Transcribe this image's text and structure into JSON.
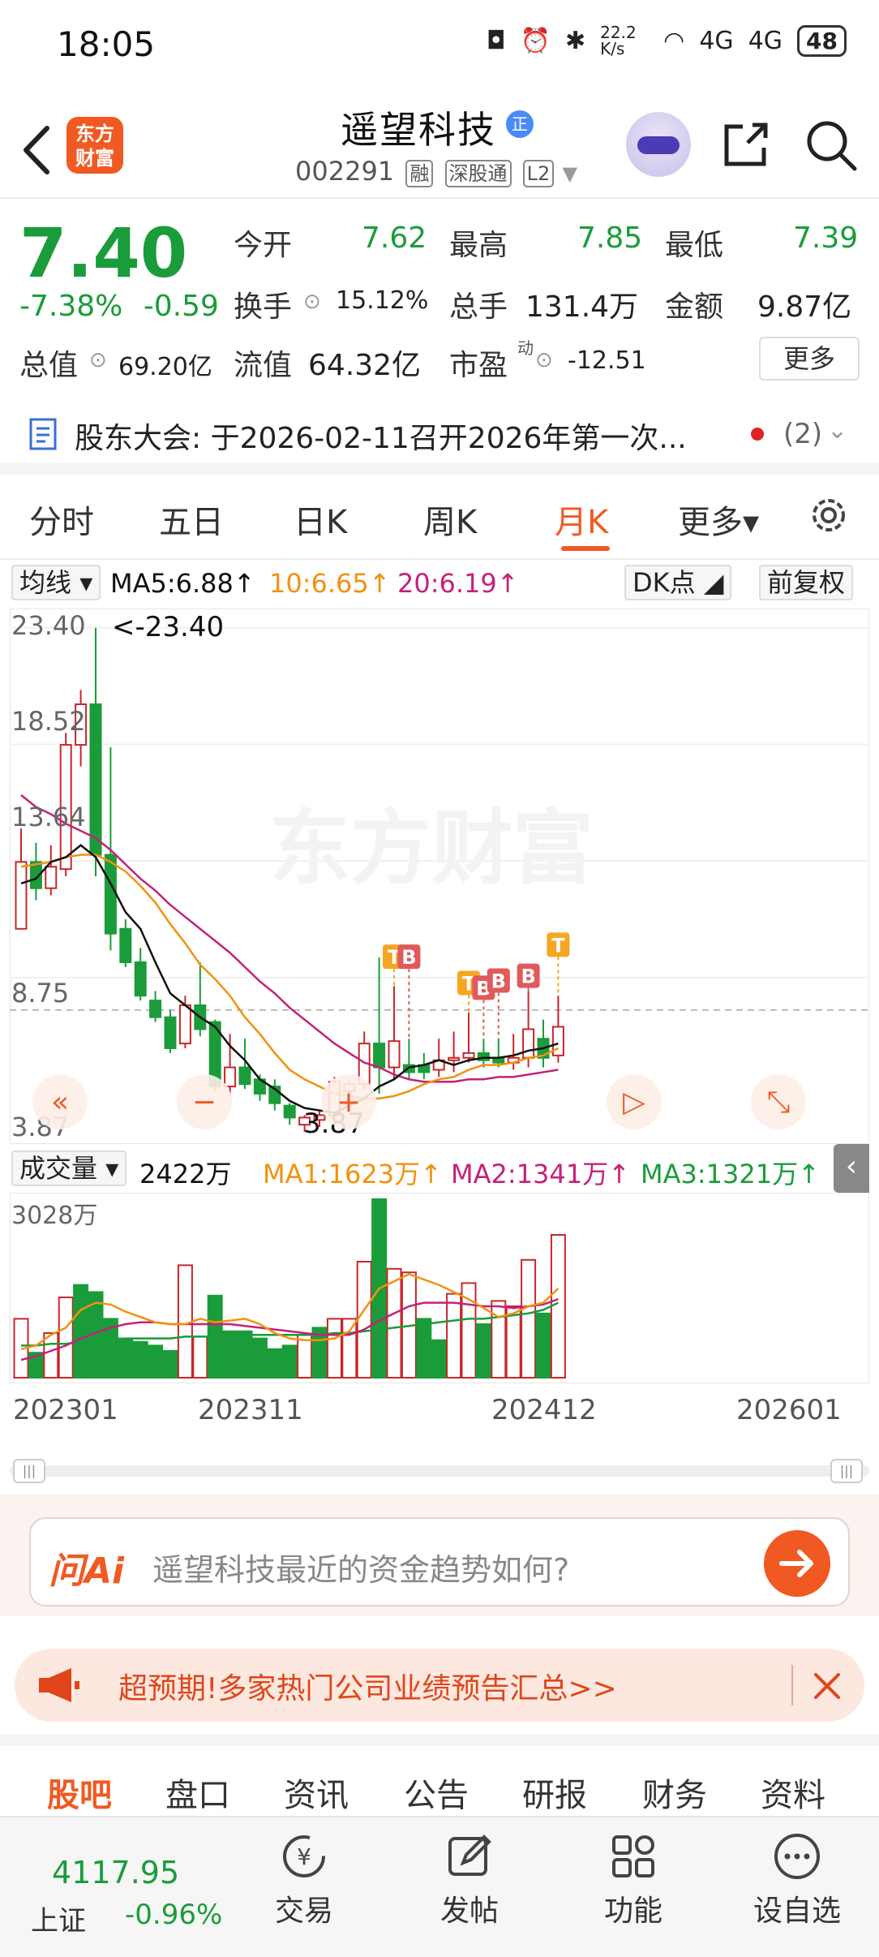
{
  "status": {
    "time": "18:05",
    "net_speed": "22.2 K/s",
    "signal1": "4G",
    "signal2": "4G",
    "battery": "48"
  },
  "header": {
    "logo_text": "东方财富",
    "stock_name": "遥望科技",
    "name_badge": "正",
    "stock_code": "002291",
    "tags": [
      "融",
      "深股通",
      "L2"
    ]
  },
  "quote": {
    "price": "7.40",
    "change_pct": "-7.38%",
    "change_abs": "-0.59",
    "open_label": "今开",
    "open": "7.62",
    "high_label": "最高",
    "high": "7.85",
    "low_label": "最低",
    "low": "7.39",
    "turnover_label": "换手",
    "turnover": "15.12%",
    "volume_label": "总手",
    "volume": "131.4万",
    "amount_label": "金额",
    "amount": "9.87亿",
    "mcap_label": "总值",
    "mcap": "69.20亿",
    "float_label": "流值",
    "float_cap": "64.32亿",
    "pe_label": "市盈",
    "pe_sup": "动",
    "pe": "-12.51",
    "more_label": "更多"
  },
  "notice": {
    "text": "股东大会:  于2026-02-11召开2026年第一次...",
    "count": "(2)"
  },
  "tabs": [
    {
      "label": "分时"
    },
    {
      "label": "五日"
    },
    {
      "label": "日K"
    },
    {
      "label": "周K"
    },
    {
      "label": "月K"
    },
    {
      "label": "更多▾"
    }
  ],
  "ma_row": {
    "type": "均线",
    "ma5": "MA5:6.88↑",
    "ma10": "10:6.65↑",
    "ma20": "20:6.19↑",
    "dk": "DK点",
    "adjust": "前复权"
  },
  "price_axis": {
    "labels": [
      "23.40",
      "18.52",
      "13.64",
      "8.75",
      "3.87"
    ],
    "max_label": "<-23.40",
    "min_label": "3.87",
    "watermark": "东方财富"
  },
  "markers": [
    "T",
    "B",
    "T",
    "B",
    "B",
    "B",
    "T"
  ],
  "volume_row": {
    "type": "成交量",
    "vol": "2422万",
    "ma1": "MA1:1623万↑",
    "ma2": "MA2:1341万↑",
    "ma3": "MA3:1321万↑",
    "vol_axis": "3028万"
  },
  "dates": [
    "202301",
    "202311",
    "202412",
    "202601"
  ],
  "ai": {
    "logo": "问Ai",
    "prompt": "遥望科技最近的资金趋势如何?"
  },
  "promo": {
    "text": "超预期!多家热门公司业绩预告汇总>>"
  },
  "bottom_tabs": [
    {
      "label": "股吧"
    },
    {
      "label": "盘口"
    },
    {
      "label": "资讯"
    },
    {
      "label": "公告"
    },
    {
      "label": "研报"
    },
    {
      "label": "财务"
    },
    {
      "label": "资料"
    }
  ],
  "index": {
    "value": "4117.95",
    "name": "上证",
    "change": "-0.96%"
  },
  "nav": [
    {
      "label": "交易"
    },
    {
      "label": "发帖"
    },
    {
      "label": "功能"
    },
    {
      "label": "设自选"
    }
  ],
  "colors": {
    "up": "#c8262b",
    "down": "#1a9c3a",
    "accent": "#f05a22",
    "ma5": "#111111",
    "ma10": "#f0920f",
    "ma20": "#c4217a"
  },
  "chart_data": {
    "type": "candlestick",
    "title": "",
    "xlabel": "",
    "ylabel": "",
    "ylim": [
      3.87,
      23.4
    ],
    "candles": [
      [
        10.8,
        13.6,
        12.2,
        15.0,
        "u"
      ],
      [
        13.6,
        12.5,
        12.0,
        14.4,
        "d"
      ],
      [
        12.5,
        13.4,
        12.2,
        14.3,
        "u"
      ],
      [
        13.3,
        18.5,
        13.0,
        19.0,
        "u"
      ],
      [
        18.5,
        20.2,
        17.6,
        20.8,
        "u"
      ],
      [
        20.2,
        13.9,
        13.0,
        23.4,
        "d"
      ],
      [
        13.9,
        10.6,
        9.9,
        18.4,
        "d"
      ],
      [
        10.8,
        9.4,
        9.2,
        11.2,
        "d"
      ],
      [
        9.4,
        8.0,
        7.8,
        10.0,
        "d"
      ],
      [
        7.8,
        7.1,
        6.9,
        8.2,
        "d"
      ],
      [
        7.1,
        5.8,
        5.6,
        7.4,
        "d"
      ],
      [
        6.0,
        7.6,
        5.8,
        8.0,
        "u"
      ],
      [
        7.6,
        6.6,
        6.3,
        9.4,
        "d"
      ],
      [
        6.9,
        4.2,
        4.0,
        7.0,
        "d"
      ],
      [
        4.2,
        5.0,
        3.8,
        6.4,
        "u"
      ],
      [
        5.0,
        4.3,
        4.1,
        6.2,
        "d"
      ],
      [
        4.5,
        3.9,
        3.6,
        4.7,
        "d"
      ],
      [
        4.2,
        3.5,
        3.2,
        4.5,
        "d"
      ],
      [
        3.4,
        2.9,
        2.6,
        3.5,
        "d"
      ],
      [
        2.6,
        2.9,
        2.3,
        3.0,
        "u"
      ],
      [
        2.8,
        3.0,
        2.5,
        3.2,
        "u"
      ],
      [
        3.0,
        4.4,
        2.8,
        4.6,
        "u"
      ],
      [
        4.0,
        4.3,
        3.6,
        4.4,
        "u"
      ],
      [
        4.3,
        6.0,
        4.1,
        6.5,
        "u"
      ],
      [
        6.0,
        5.0,
        3.9,
        9.6,
        "d"
      ],
      [
        5.0,
        6.1,
        4.5,
        8.4,
        "u"
      ],
      [
        5.1,
        4.8,
        4.5,
        6.2,
        "d"
      ],
      [
        5.1,
        4.8,
        4.5,
        5.6,
        "d"
      ],
      [
        4.9,
        5.3,
        4.6,
        6.2,
        "u"
      ],
      [
        5.3,
        5.4,
        4.8,
        6.5,
        "u"
      ],
      [
        5.4,
        5.6,
        5.2,
        7.3,
        "u"
      ],
      [
        5.6,
        5.3,
        5.0,
        6.2,
        "d"
      ],
      [
        5.4,
        5.2,
        5.0,
        6.2,
        "d"
      ],
      [
        5.2,
        5.4,
        4.9,
        6.4,
        "u"
      ],
      [
        5.4,
        6.6,
        5.0,
        8.2,
        "u"
      ],
      [
        6.2,
        5.4,
        5.0,
        7.0,
        "d"
      ],
      [
        5.5,
        6.7,
        5.2,
        8.0,
        "u"
      ]
    ],
    "ma5": [
      12.7,
      12.9,
      13.6,
      13.8,
      14.3,
      13.8,
      12.7,
      11.5,
      10.8,
      9.4,
      8.1,
      7.6,
      7.1,
      6.7,
      5.9,
      5.3,
      4.5,
      4.1,
      3.6,
      3.3,
      3.2,
      3.1,
      3.4,
      3.7,
      4.2,
      4.5,
      5.0,
      5.1,
      5.3,
      5.1,
      5.3,
      5.4,
      5.4,
      5.5,
      5.7,
      5.8,
      6.0
    ],
    "ma10": [
      13.4,
      13.5,
      13.6,
      13.8,
      13.9,
      13.9,
      13.6,
      13.2,
      12.6,
      11.9,
      11.0,
      10.2,
      9.3,
      8.7,
      8.0,
      7.1,
      6.4,
      5.6,
      4.9,
      4.5,
      4.2,
      3.9,
      3.8,
      3.7,
      3.7,
      3.8,
      4.0,
      4.3,
      4.5,
      4.6,
      4.9,
      5.1,
      5.1,
      5.2,
      5.4,
      5.5,
      5.8
    ],
    "ma20": [
      16.4,
      15.9,
      15.6,
      15.2,
      14.9,
      14.6,
      14.1,
      13.5,
      12.9,
      12.4,
      11.8,
      11.3,
      10.8,
      10.3,
      9.8,
      9.2,
      8.6,
      8.1,
      7.5,
      7.0,
      6.5,
      6.0,
      5.6,
      5.2,
      5.0,
      4.7,
      4.5,
      4.4,
      4.4,
      4.4,
      4.5,
      4.5,
      4.6,
      4.6,
      4.7,
      4.8,
      4.9
    ],
    "volume": [
      [
        0.33,
        "u"
      ],
      [
        0.14,
        "d"
      ],
      [
        0.25,
        "u"
      ],
      [
        0.45,
        "u"
      ],
      [
        0.52,
        "d"
      ],
      [
        0.48,
        "d"
      ],
      [
        0.33,
        "d"
      ],
      [
        0.22,
        "d"
      ],
      [
        0.2,
        "d"
      ],
      [
        0.18,
        "d"
      ],
      [
        0.15,
        "d"
      ],
      [
        0.63,
        "u"
      ],
      [
        0.23,
        "u"
      ],
      [
        0.46,
        "d"
      ],
      [
        0.26,
        "d"
      ],
      [
        0.26,
        "d"
      ],
      [
        0.22,
        "d"
      ],
      [
        0.16,
        "d"
      ],
      [
        0.18,
        "d"
      ],
      [
        0.24,
        "u"
      ],
      [
        0.28,
        "d"
      ],
      [
        0.33,
        "u"
      ],
      [
        0.33,
        "u"
      ],
      [
        0.65,
        "u"
      ],
      [
        1.0,
        "d"
      ],
      [
        0.61,
        "u"
      ],
      [
        0.59,
        "u"
      ],
      [
        0.33,
        "d"
      ],
      [
        0.21,
        "d"
      ],
      [
        0.47,
        "u"
      ],
      [
        0.53,
        "u"
      ],
      [
        0.3,
        "d"
      ],
      [
        0.43,
        "u"
      ],
      [
        0.4,
        "u"
      ],
      [
        0.66,
        "u"
      ],
      [
        0.36,
        "d"
      ],
      [
        0.8,
        "u"
      ]
    ],
    "vol_ma1": [
      0.16,
      0.18,
      0.24,
      0.28,
      0.38,
      0.42,
      0.41,
      0.37,
      0.34,
      0.31,
      0.3,
      0.3,
      0.33,
      0.31,
      0.32,
      0.33,
      0.3,
      0.25,
      0.22,
      0.21,
      0.21,
      0.22,
      0.26,
      0.38,
      0.5,
      0.54,
      0.58,
      0.55,
      0.52,
      0.48,
      0.44,
      0.39,
      0.34,
      0.36,
      0.4,
      0.42,
      0.5
    ],
    "vol_ma2": [
      0.1,
      0.12,
      0.15,
      0.18,
      0.22,
      0.25,
      0.28,
      0.3,
      0.31,
      0.31,
      0.3,
      0.3,
      0.3,
      0.3,
      0.3,
      0.29,
      0.28,
      0.27,
      0.26,
      0.25,
      0.24,
      0.24,
      0.24,
      0.27,
      0.32,
      0.36,
      0.4,
      0.42,
      0.42,
      0.42,
      0.41,
      0.4,
      0.4,
      0.39,
      0.4,
      0.41,
      0.44
    ],
    "vol_ma3": [
      0.18,
      0.18,
      0.19,
      0.19,
      0.2,
      0.21,
      0.21,
      0.22,
      0.22,
      0.22,
      0.22,
      0.23,
      0.23,
      0.23,
      0.23,
      0.24,
      0.24,
      0.24,
      0.24,
      0.24,
      0.24,
      0.25,
      0.25,
      0.26,
      0.27,
      0.28,
      0.29,
      0.3,
      0.31,
      0.32,
      0.33,
      0.33,
      0.34,
      0.35,
      0.36,
      0.38,
      0.42
    ]
  }
}
